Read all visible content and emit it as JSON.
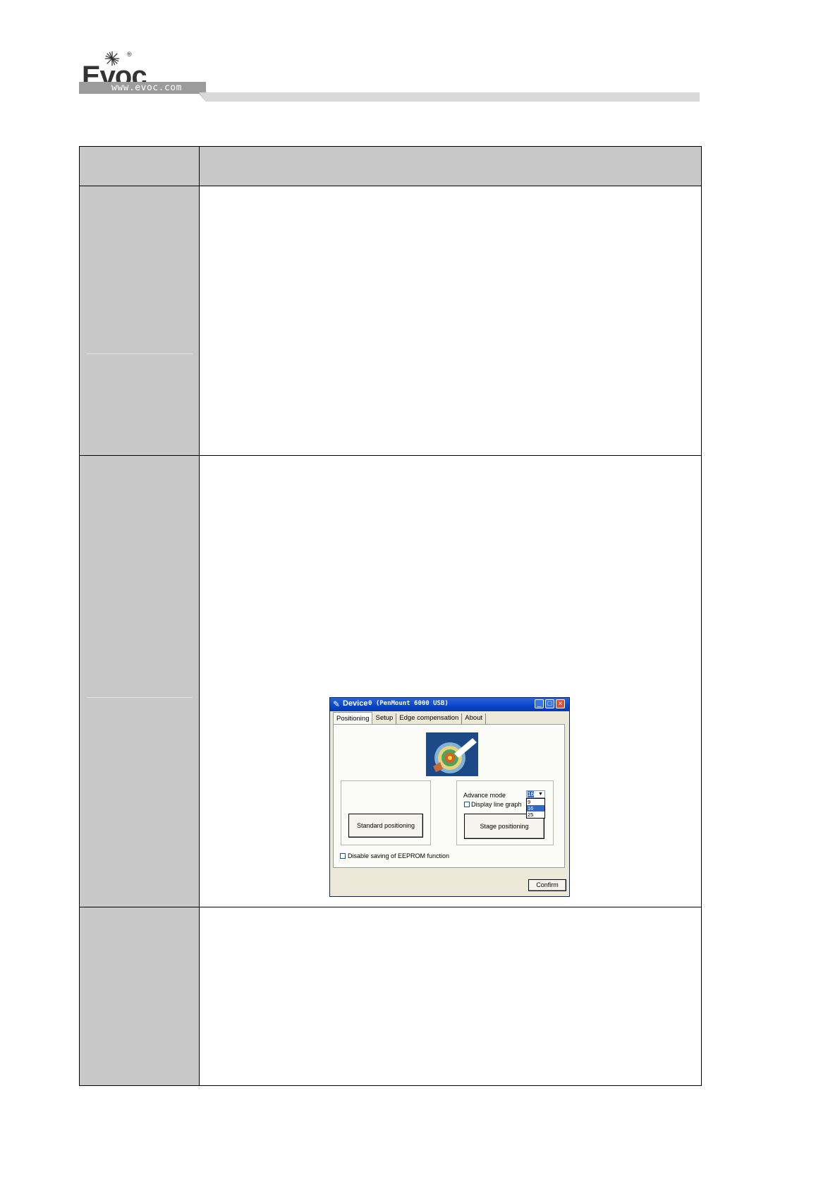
{
  "header": {
    "logo_text": "Evoc",
    "website": "www.evoc.com",
    "registered_mark": "®"
  },
  "dialog": {
    "title": "Device",
    "title_suffix": "0 (PenMount 6000 USB)",
    "tabs": [
      "Positioning",
      "Setup",
      "Edge compensation",
      "About"
    ],
    "active_tab": "Positioning",
    "standard_positioning_label": "Standard positioning",
    "stage_positioning_label": "Stage positioning",
    "advance_mode_label": "Advance mode",
    "advance_mode_value": "16",
    "advance_mode_options": [
      "9",
      "16",
      "25"
    ],
    "display_line_graph_label": "Display line graph",
    "disable_eeprom_label": "Disable saving of EEPROM function",
    "confirm_label": "Confirm",
    "window_controls": {
      "minimize": "_",
      "maximize": "□",
      "close": "×"
    }
  }
}
